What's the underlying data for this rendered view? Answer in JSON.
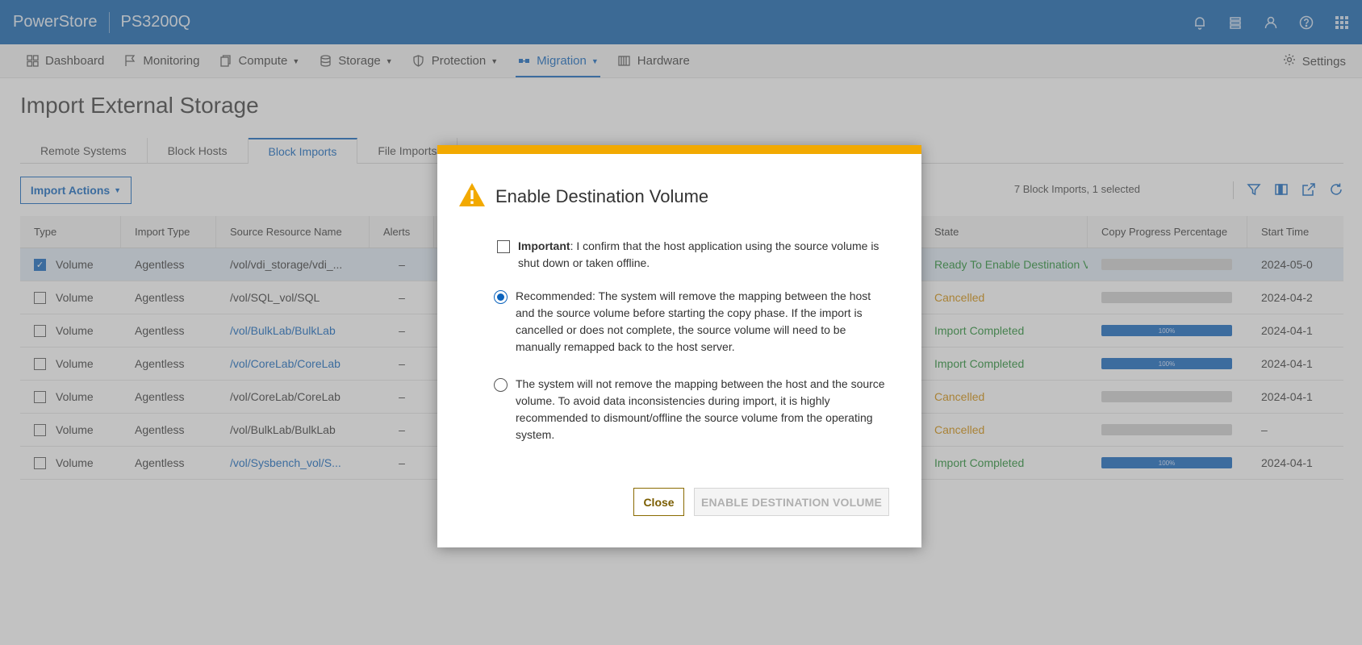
{
  "header": {
    "brand": "PowerStore",
    "system": "PS3200Q"
  },
  "nav": {
    "items": [
      {
        "label": "Dashboard",
        "icon": "dashboard-icon",
        "caret": false
      },
      {
        "label": "Monitoring",
        "icon": "flag-icon",
        "caret": false
      },
      {
        "label": "Compute",
        "icon": "compute-icon",
        "caret": true
      },
      {
        "label": "Storage",
        "icon": "database-icon",
        "caret": true
      },
      {
        "label": "Protection",
        "icon": "shield-icon",
        "caret": true
      },
      {
        "label": "Migration",
        "icon": "migration-icon",
        "caret": true,
        "active": true
      },
      {
        "label": "Hardware",
        "icon": "hardware-icon",
        "caret": false
      }
    ],
    "settings_label": "Settings"
  },
  "page": {
    "title": "Import External Storage",
    "tabs": [
      "Remote Systems",
      "Block Hosts",
      "Block Imports",
      "File Imports"
    ],
    "active_tab": "Block Imports",
    "import_actions_label": "Import Actions",
    "count_label": "7 Block Imports, 1 selected"
  },
  "table": {
    "columns": [
      "Type",
      "Import Type",
      "Source Resource Name",
      "Alerts",
      "State",
      "Copy Progress Percentage",
      "Start Time"
    ],
    "rows": [
      {
        "type": "Volume",
        "import_type": "Agentless",
        "source": "/vol/vdi_storage/vdi_...",
        "alerts": "–",
        "state": "Ready To Enable Destination Volume",
        "progress": 0,
        "progress_label": "",
        "start": "2024-05-0",
        "selected": true,
        "link": false,
        "state_color": "green"
      },
      {
        "type": "Volume",
        "import_type": "Agentless",
        "source": "/vol/SQL_vol/SQL",
        "alerts": "–",
        "state": "Cancelled",
        "progress": 0,
        "progress_label": "",
        "start": "2024-04-2",
        "selected": false,
        "link": false,
        "state_color": "orange"
      },
      {
        "type": "Volume",
        "import_type": "Agentless",
        "source": "/vol/BulkLab/BulkLab",
        "alerts": "–",
        "state": "Import Completed",
        "progress": 100,
        "progress_label": "100%",
        "start": "2024-04-1",
        "selected": false,
        "link": true,
        "state_color": "green"
      },
      {
        "type": "Volume",
        "import_type": "Agentless",
        "source": "/vol/CoreLab/CoreLab",
        "alerts": "–",
        "state": "Import Completed",
        "progress": 100,
        "progress_label": "100%",
        "start": "2024-04-1",
        "selected": false,
        "link": true,
        "state_color": "green"
      },
      {
        "type": "Volume",
        "import_type": "Agentless",
        "source": "/vol/CoreLab/CoreLab",
        "alerts": "–",
        "state": "Cancelled",
        "progress": 0,
        "progress_label": "",
        "start": "2024-04-1",
        "selected": false,
        "link": false,
        "state_color": "orange"
      },
      {
        "type": "Volume",
        "import_type": "Agentless",
        "source": "/vol/BulkLab/BulkLab",
        "alerts": "–",
        "state": "Cancelled",
        "progress": 0,
        "progress_label": "",
        "start": "–",
        "selected": false,
        "link": false,
        "state_color": "orange"
      },
      {
        "type": "Volume",
        "import_type": "Agentless",
        "source": "/vol/Sysbench_vol/S...",
        "alerts": "–",
        "state": "Import Completed",
        "progress": 100,
        "progress_label": "100%",
        "start": "2024-04-1",
        "selected": false,
        "link": true,
        "state_color": "green"
      }
    ]
  },
  "dialog": {
    "title": "Enable Destination Volume",
    "confirm_bold": "Important",
    "confirm_text": ": I confirm that the host application using the source volume is shut down or taken offline.",
    "confirm_checked": false,
    "option1": "Recommended: The system will remove the mapping between the host and the source volume before starting the copy phase. If the import is cancelled or does not complete, the source volume will need to be manually remapped back to the host server.",
    "option2": "The system will not remove the mapping between the host and the source volume. To avoid data inconsistencies during import, it is highly recommended to dismount/offline the source volume from the operating system.",
    "selected_option": 1,
    "close_label": "Close",
    "enable_label": "ENABLE DESTINATION VOLUME"
  },
  "colors": {
    "brand_blue": "#0b5fae",
    "accent": "#0b63bd",
    "warning": "#f2a900"
  }
}
